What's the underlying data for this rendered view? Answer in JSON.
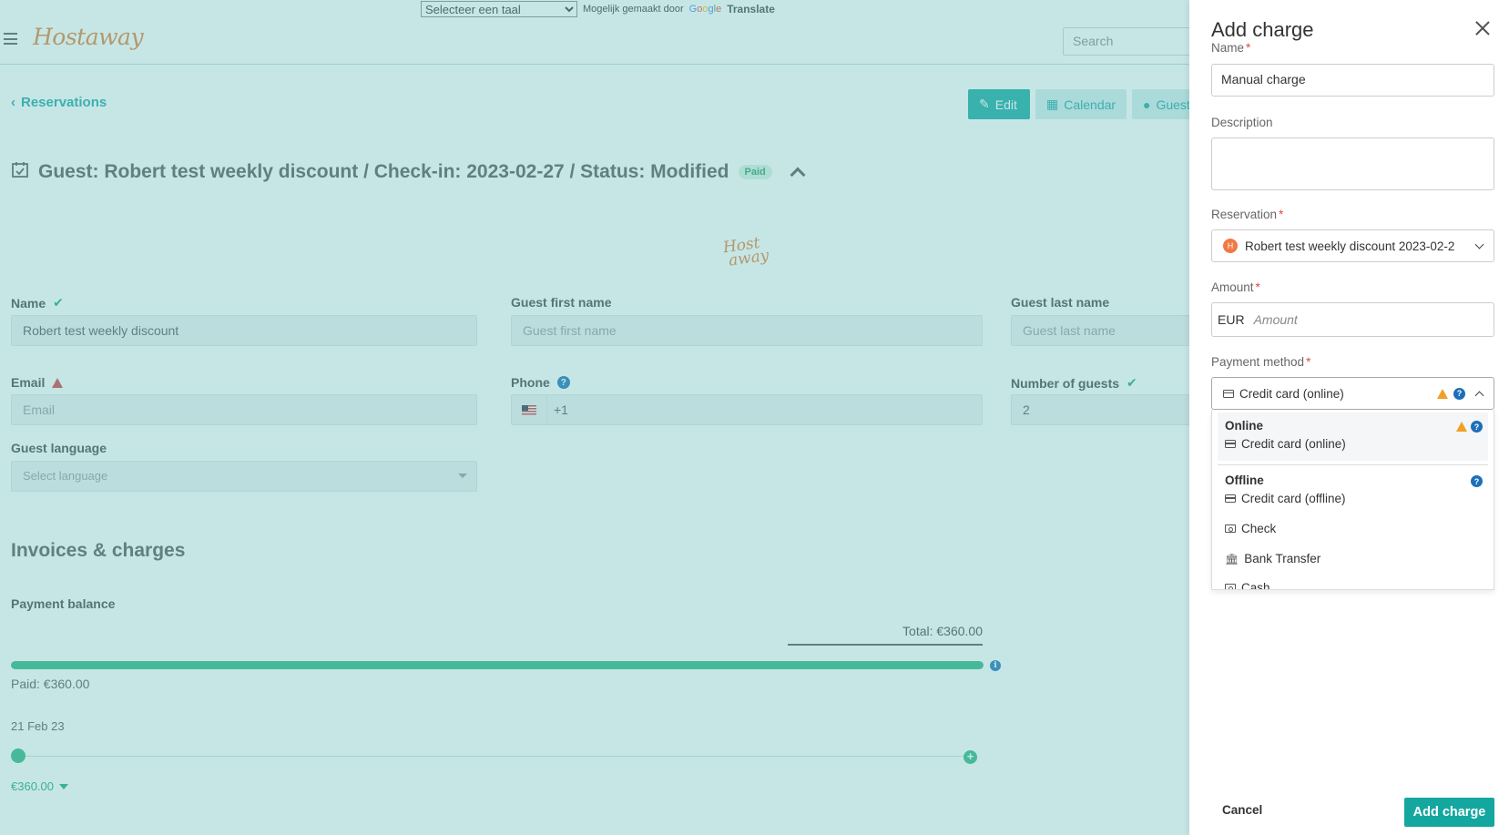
{
  "translate": {
    "select_value": "Selecteer een taal",
    "powered_prefix": "Mogelijk gemaakt door",
    "google_g": "G",
    "google_o1": "o",
    "google_o2": "o",
    "google_g2": "g",
    "google_l": "l",
    "google_e": "e",
    "translate_word": "Translate"
  },
  "header": {
    "logo": "Hostaway",
    "search_placeholder": "Search"
  },
  "nav": {
    "back_label": "Reservations",
    "edit_label": "Edit",
    "calendar_label": "Calendar",
    "guest_label": "Guest"
  },
  "reservation": {
    "title": "Guest: Robert test weekly discount / Check-in: 2023-02-27 / Status: Modified",
    "status_badge": "Paid",
    "center_logo_line1": "Host",
    "center_logo_line2": "away"
  },
  "form": {
    "name_label": "Name",
    "name_value": "Robert test weekly discount",
    "first_name_label": "Guest first name",
    "first_name_placeholder": "Guest first name",
    "last_name_label": "Guest last name",
    "last_name_placeholder": "Guest last name",
    "email_label": "Email",
    "email_placeholder": "Email",
    "phone_label": "Phone",
    "phone_value": "+1",
    "guests_label": "Number of guests",
    "guests_value": "2",
    "language_label": "Guest language",
    "language_placeholder": "Select language"
  },
  "invoices": {
    "section_title": "Invoices & charges",
    "balance_title": "Payment balance",
    "total_text": "Total: €360.00",
    "paid_text": "Paid: €360.00",
    "paid_progress": 1.0,
    "date_text": "21 Feb 23",
    "amount_text": "€360.00"
  },
  "drawer": {
    "title": "Add charge",
    "name_label": "Name",
    "name_value": "Manual charge",
    "description_label": "Description",
    "reservation_label": "Reservation",
    "reservation_value": "Robert test weekly discount 2023-02-2",
    "amount_label": "Amount",
    "currency": "EUR",
    "amount_placeholder": "Amount",
    "payment_label": "Payment method",
    "payment_value": "Credit card (online)",
    "required_mark": "*",
    "dropdown": {
      "online_heading": "Online",
      "online_option": "Credit card (online)",
      "offline_heading": "Offline",
      "offline_option": "Credit card (offline)",
      "check_option": "Check",
      "bank_option": "Bank Transfer",
      "cash_option": "Cash"
    },
    "cancel_label": "Cancel",
    "submit_label": "Add charge"
  },
  "colors": {
    "accent": "#14a7a0",
    "success": "#2cb581",
    "logo": "#e27d34",
    "overlay": "#70c0c0",
    "required": "#e04848"
  }
}
